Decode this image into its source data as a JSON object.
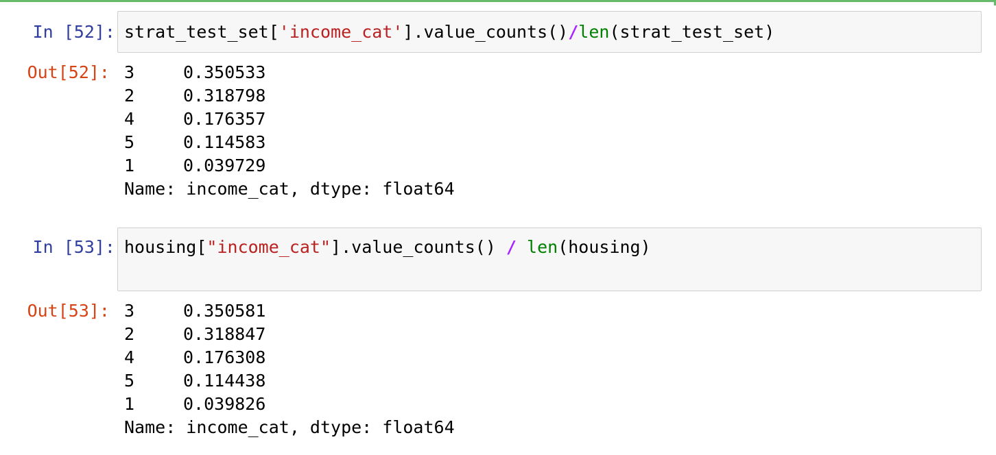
{
  "cells": [
    {
      "in_prompt": "In [52]:",
      "code": {
        "part1": "strat_test_set[",
        "str": "'income_cat'",
        "part2": "].value_counts()",
        "op": "/",
        "builtin": "len",
        "part3": "(strat_test_set)"
      },
      "out_prompt": "Out[52]:",
      "output": {
        "rows": [
          {
            "index": "3",
            "value": "0.350533"
          },
          {
            "index": "2",
            "value": "0.318798"
          },
          {
            "index": "4",
            "value": "0.176357"
          },
          {
            "index": "5",
            "value": "0.114583"
          },
          {
            "index": "1",
            "value": "0.039729"
          }
        ],
        "footer": "Name: income_cat, dtype: float64"
      }
    },
    {
      "in_prompt": "In [53]:",
      "code": {
        "part1": "housing[",
        "str": "\"income_cat\"",
        "part2": "].value_counts() ",
        "op": "/",
        "space": " ",
        "builtin": "len",
        "part3": "(housing)"
      },
      "out_prompt": "Out[53]:",
      "output": {
        "rows": [
          {
            "index": "3",
            "value": "0.350581"
          },
          {
            "index": "2",
            "value": "0.318847"
          },
          {
            "index": "4",
            "value": "0.176308"
          },
          {
            "index": "5",
            "value": "0.114438"
          },
          {
            "index": "1",
            "value": "0.039826"
          }
        ],
        "footer": "Name: income_cat, dtype: float64"
      }
    }
  ],
  "colors": {
    "in_prompt": "#303f9f",
    "out_prompt": "#d84315",
    "string": "#ba2121",
    "operator": "#aa22ff",
    "builtin": "#008000",
    "cell_border_selected": "#66bb6a"
  }
}
